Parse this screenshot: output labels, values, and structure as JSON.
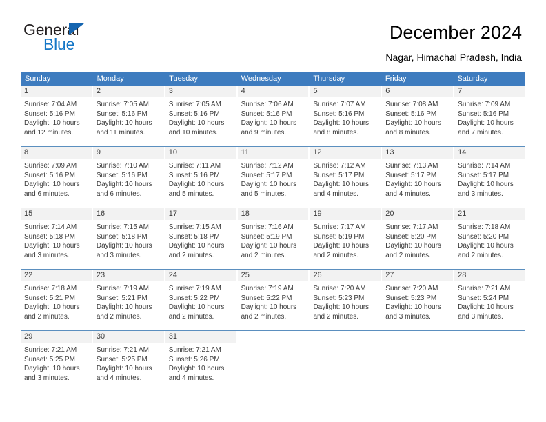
{
  "brand": {
    "name_top": "General",
    "name_bottom": "Blue",
    "triangle_color": "#1565b0",
    "blue_color": "#1577c7"
  },
  "header": {
    "title": "December 2024",
    "subtitle": "Nagar, Himachal Pradesh, India"
  },
  "theme": {
    "header_blue": "#3e7cbf",
    "row_rule": "#5b8fbf",
    "daynum_band": "#f2f2f2",
    "text": "#3c3c3c"
  },
  "weekdays": [
    "Sunday",
    "Monday",
    "Tuesday",
    "Wednesday",
    "Thursday",
    "Friday",
    "Saturday"
  ],
  "weeks": [
    [
      {
        "day": "1",
        "lines": [
          "Sunrise: 7:04 AM",
          "Sunset: 5:16 PM",
          "Daylight: 10 hours",
          "and 12 minutes."
        ]
      },
      {
        "day": "2",
        "lines": [
          "Sunrise: 7:05 AM",
          "Sunset: 5:16 PM",
          "Daylight: 10 hours",
          "and 11 minutes."
        ]
      },
      {
        "day": "3",
        "lines": [
          "Sunrise: 7:05 AM",
          "Sunset: 5:16 PM",
          "Daylight: 10 hours",
          "and 10 minutes."
        ]
      },
      {
        "day": "4",
        "lines": [
          "Sunrise: 7:06 AM",
          "Sunset: 5:16 PM",
          "Daylight: 10 hours",
          "and 9 minutes."
        ]
      },
      {
        "day": "5",
        "lines": [
          "Sunrise: 7:07 AM",
          "Sunset: 5:16 PM",
          "Daylight: 10 hours",
          "and 8 minutes."
        ]
      },
      {
        "day": "6",
        "lines": [
          "Sunrise: 7:08 AM",
          "Sunset: 5:16 PM",
          "Daylight: 10 hours",
          "and 8 minutes."
        ]
      },
      {
        "day": "7",
        "lines": [
          "Sunrise: 7:09 AM",
          "Sunset: 5:16 PM",
          "Daylight: 10 hours",
          "and 7 minutes."
        ]
      }
    ],
    [
      {
        "day": "8",
        "lines": [
          "Sunrise: 7:09 AM",
          "Sunset: 5:16 PM",
          "Daylight: 10 hours",
          "and 6 minutes."
        ]
      },
      {
        "day": "9",
        "lines": [
          "Sunrise: 7:10 AM",
          "Sunset: 5:16 PM",
          "Daylight: 10 hours",
          "and 6 minutes."
        ]
      },
      {
        "day": "10",
        "lines": [
          "Sunrise: 7:11 AM",
          "Sunset: 5:16 PM",
          "Daylight: 10 hours",
          "and 5 minutes."
        ]
      },
      {
        "day": "11",
        "lines": [
          "Sunrise: 7:12 AM",
          "Sunset: 5:17 PM",
          "Daylight: 10 hours",
          "and 5 minutes."
        ]
      },
      {
        "day": "12",
        "lines": [
          "Sunrise: 7:12 AM",
          "Sunset: 5:17 PM",
          "Daylight: 10 hours",
          "and 4 minutes."
        ]
      },
      {
        "day": "13",
        "lines": [
          "Sunrise: 7:13 AM",
          "Sunset: 5:17 PM",
          "Daylight: 10 hours",
          "and 4 minutes."
        ]
      },
      {
        "day": "14",
        "lines": [
          "Sunrise: 7:14 AM",
          "Sunset: 5:17 PM",
          "Daylight: 10 hours",
          "and 3 minutes."
        ]
      }
    ],
    [
      {
        "day": "15",
        "lines": [
          "Sunrise: 7:14 AM",
          "Sunset: 5:18 PM",
          "Daylight: 10 hours",
          "and 3 minutes."
        ]
      },
      {
        "day": "16",
        "lines": [
          "Sunrise: 7:15 AM",
          "Sunset: 5:18 PM",
          "Daylight: 10 hours",
          "and 3 minutes."
        ]
      },
      {
        "day": "17",
        "lines": [
          "Sunrise: 7:15 AM",
          "Sunset: 5:18 PM",
          "Daylight: 10 hours",
          "and 2 minutes."
        ]
      },
      {
        "day": "18",
        "lines": [
          "Sunrise: 7:16 AM",
          "Sunset: 5:19 PM",
          "Daylight: 10 hours",
          "and 2 minutes."
        ]
      },
      {
        "day": "19",
        "lines": [
          "Sunrise: 7:17 AM",
          "Sunset: 5:19 PM",
          "Daylight: 10 hours",
          "and 2 minutes."
        ]
      },
      {
        "day": "20",
        "lines": [
          "Sunrise: 7:17 AM",
          "Sunset: 5:20 PM",
          "Daylight: 10 hours",
          "and 2 minutes."
        ]
      },
      {
        "day": "21",
        "lines": [
          "Sunrise: 7:18 AM",
          "Sunset: 5:20 PM",
          "Daylight: 10 hours",
          "and 2 minutes."
        ]
      }
    ],
    [
      {
        "day": "22",
        "lines": [
          "Sunrise: 7:18 AM",
          "Sunset: 5:21 PM",
          "Daylight: 10 hours",
          "and 2 minutes."
        ]
      },
      {
        "day": "23",
        "lines": [
          "Sunrise: 7:19 AM",
          "Sunset: 5:21 PM",
          "Daylight: 10 hours",
          "and 2 minutes."
        ]
      },
      {
        "day": "24",
        "lines": [
          "Sunrise: 7:19 AM",
          "Sunset: 5:22 PM",
          "Daylight: 10 hours",
          "and 2 minutes."
        ]
      },
      {
        "day": "25",
        "lines": [
          "Sunrise: 7:19 AM",
          "Sunset: 5:22 PM",
          "Daylight: 10 hours",
          "and 2 minutes."
        ]
      },
      {
        "day": "26",
        "lines": [
          "Sunrise: 7:20 AM",
          "Sunset: 5:23 PM",
          "Daylight: 10 hours",
          "and 2 minutes."
        ]
      },
      {
        "day": "27",
        "lines": [
          "Sunrise: 7:20 AM",
          "Sunset: 5:23 PM",
          "Daylight: 10 hours",
          "and 3 minutes."
        ]
      },
      {
        "day": "28",
        "lines": [
          "Sunrise: 7:21 AM",
          "Sunset: 5:24 PM",
          "Daylight: 10 hours",
          "and 3 minutes."
        ]
      }
    ],
    [
      {
        "day": "29",
        "lines": [
          "Sunrise: 7:21 AM",
          "Sunset: 5:25 PM",
          "Daylight: 10 hours",
          "and 3 minutes."
        ]
      },
      {
        "day": "30",
        "lines": [
          "Sunrise: 7:21 AM",
          "Sunset: 5:25 PM",
          "Daylight: 10 hours",
          "and 4 minutes."
        ]
      },
      {
        "day": "31",
        "lines": [
          "Sunrise: 7:21 AM",
          "Sunset: 5:26 PM",
          "Daylight: 10 hours",
          "and 4 minutes."
        ]
      },
      {
        "day": "",
        "lines": []
      },
      {
        "day": "",
        "lines": []
      },
      {
        "day": "",
        "lines": []
      },
      {
        "day": "",
        "lines": []
      }
    ]
  ]
}
